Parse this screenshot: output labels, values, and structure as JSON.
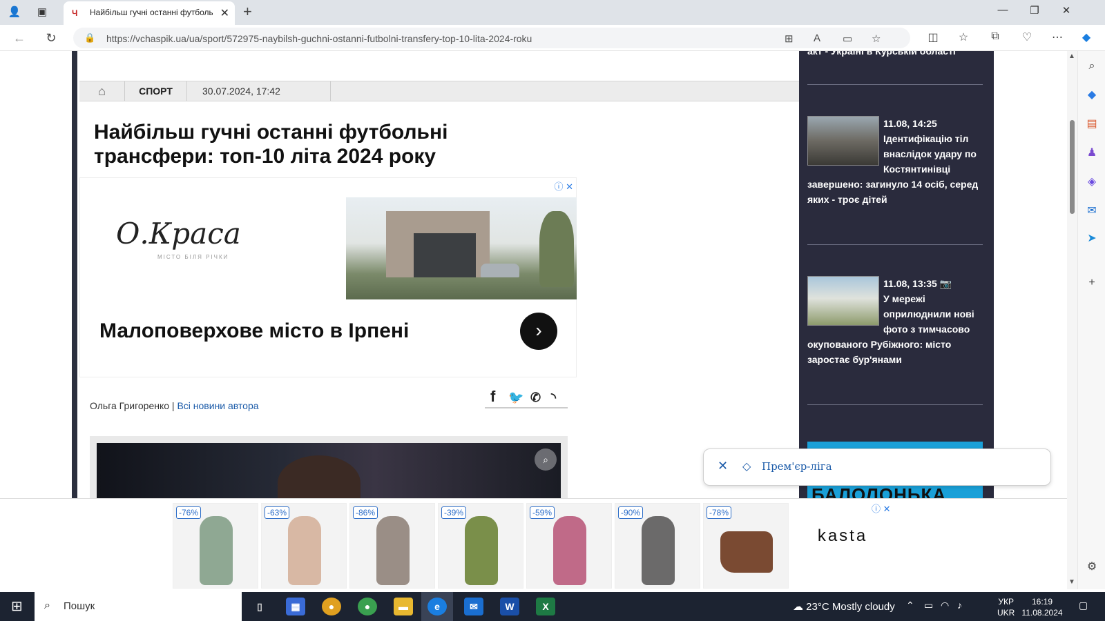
{
  "browser": {
    "tab_title": "Найбільш гучні останні футбольні трансфери",
    "url": "https://vchaspik.ua/ua/sport/572975-naybilsh-guchni-ostanni-futbolni-transfery-top-10-lita-2024-roku"
  },
  "article": {
    "section": "СПОРТ",
    "datetime": "30.07.2024, 17:42",
    "headline_line1": "Найбільш гучні останні футбольні",
    "headline_line2": "трансфери: топ-10 літа 2024 року",
    "author": "Ольга Григоренко |",
    "author_link": "Всі новини автора"
  },
  "ad_top": {
    "logo": "О.Краса",
    "logo_sub": "МІСТО БІЛЯ РІЧКИ",
    "tagline": "Малоповерхове місто в Ірпені"
  },
  "news": {
    "top_snippet": "акт - Україні в Курській області",
    "items": [
      {
        "time": "11.08, 14:25",
        "title": "Ідентифікацію тіл внаслідок удару по Костянтинівці завершено: загинуло 14 осіб, серед яких - троє дітей"
      },
      {
        "time": "11.08, 13:35",
        "title": "У мережі оприлюднили нові фото з тимчасово окупованого Рубіжного: місто заростає бур'янами"
      }
    ],
    "ad_text": "БАЛОЛОНЬКА"
  },
  "tag_popup": {
    "label": "Прем'єр-ліга"
  },
  "bottom_ad": {
    "discounts": [
      "-76%",
      "-63%",
      "-86%",
      "-39%",
      "-59%",
      "-90%",
      "-78%"
    ],
    "brand": "kasta"
  },
  "taskbar": {
    "search_placeholder": "Пошук",
    "weather": "23°C  Mostly cloudy",
    "lang1": "УКР",
    "lang2": "UKR",
    "time": "16:19",
    "date": "11.08.2024"
  },
  "colors": {
    "accent": "#1a5aa8",
    "news_bg": "#2a2b3d",
    "taskbar_bg": "#1c2331"
  }
}
